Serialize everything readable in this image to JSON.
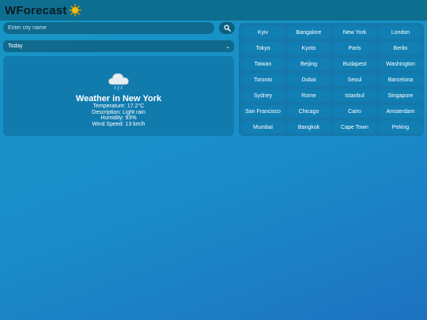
{
  "header": {
    "title": "WForecast",
    "icon": "sun-icon"
  },
  "search": {
    "placeholder": "Enter city name",
    "button_icon": "search-icon"
  },
  "period": {
    "selected": "Today"
  },
  "weather": {
    "icon": "cloud-rain-icon",
    "title": "Weather in New York",
    "temperature": "Temperature: 17.2°C",
    "description": "Description: Light rain",
    "humidity": "Humidity: 93%",
    "wind": "Wind Speed: 13 km/h"
  },
  "cities": [
    "Kyiv",
    "Bangalore",
    "New York",
    "London",
    "Tokyo",
    "Kyoto",
    "Paris",
    "Berlin",
    "Taiwan",
    "Beijing",
    "Budapest",
    "Washington",
    "Toronto",
    "Dubai",
    "Seoul",
    "Barcelona",
    "Sydney",
    "Rome",
    "Istanbul",
    "Singapore",
    "San Francisco",
    "Chicago",
    "Cairo",
    "Amsterdam",
    "Mumbai",
    "Bangkok",
    "Cape Town",
    "Peking"
  ],
  "colors": {
    "header_bg": "#0e6e8f",
    "accent": "#117fb4",
    "sun": "#f4c20d"
  }
}
